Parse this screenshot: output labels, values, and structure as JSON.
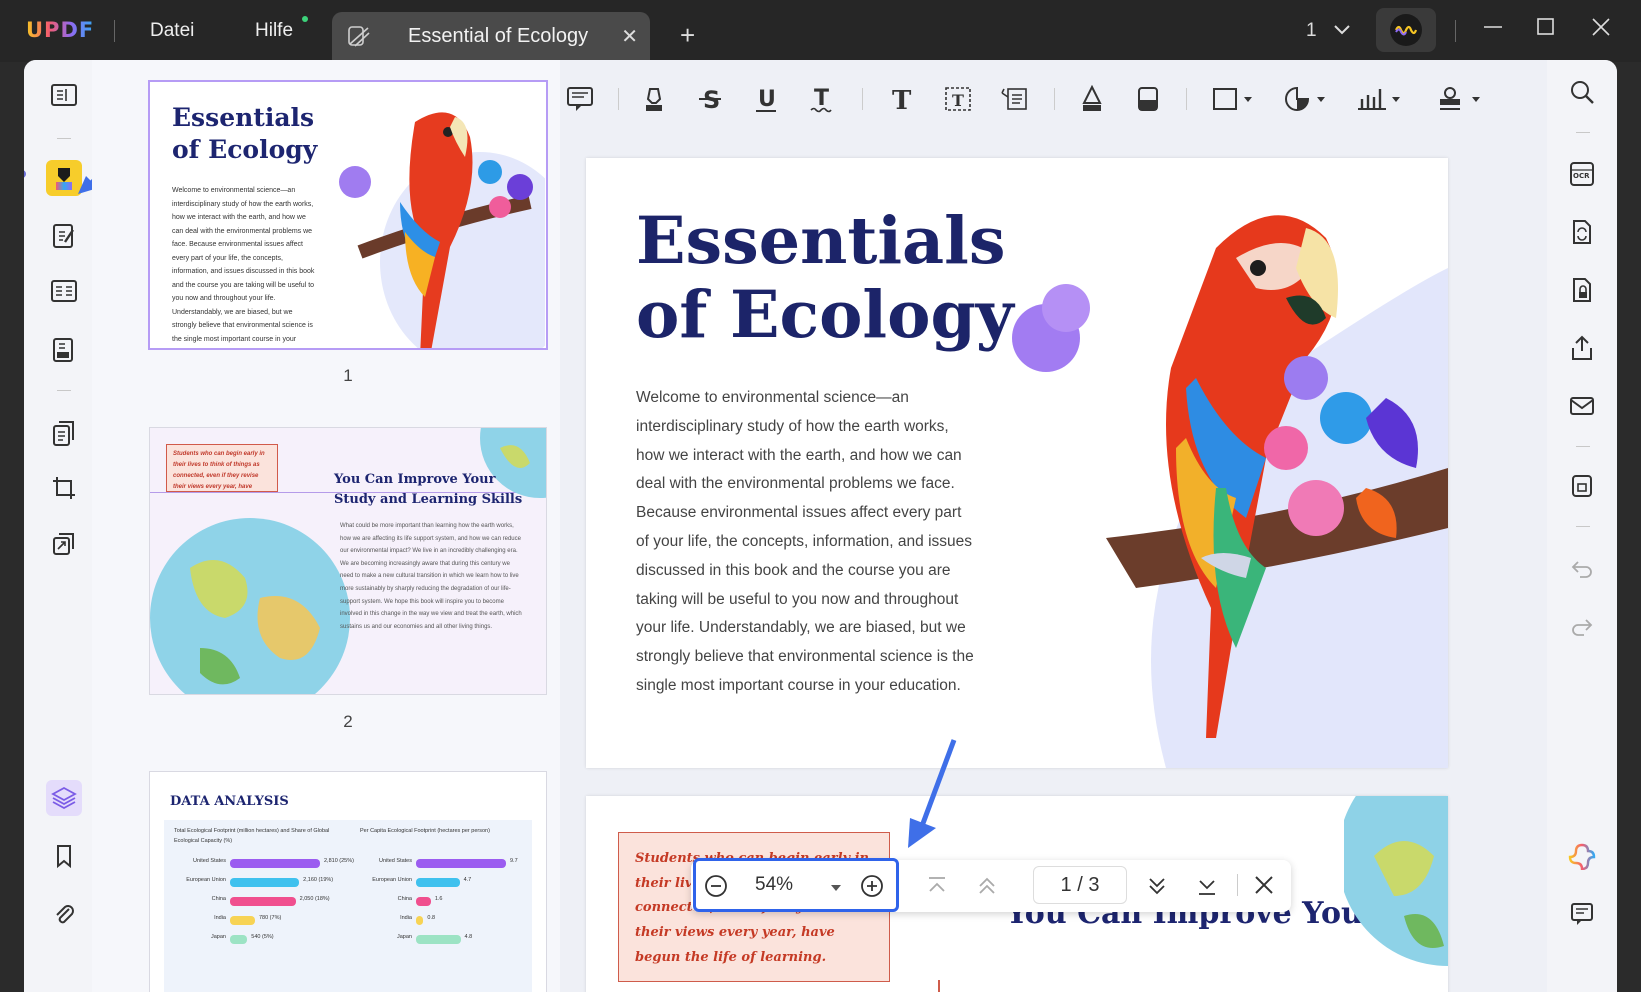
{
  "app": {
    "logo": "UPDF"
  },
  "menu": {
    "file": "Datei",
    "help": "Hilfe"
  },
  "tab": {
    "title": "Essential of Ecology",
    "close": "✕",
    "new": "+"
  },
  "window": {
    "page_selector": "1"
  },
  "thumbnails": [
    {
      "number": "1",
      "title_line1": "Essentials",
      "title_line2": "of Ecology",
      "body": "Welcome to environmental science—an interdisciplinary study of how the earth works, how we interact with the earth, and how we can deal with the environmental problems we face. Because environmental issues affect every part of your life, the concepts, information, and issues discussed in this book and the course you are taking will be useful to you now and throughout your life. Understandably, we are biased, but we strongly believe that environmental science is the single most important course in your education."
    },
    {
      "number": "2",
      "callout": "Students who can begin early in their lives to think of things as connected, even if they revise their views every year, have begun the life of learning.",
      "heading": "You Can Improve Your Study and Learning Skills",
      "body": "What could be more important than learning how the earth works, how we are affecting its life support system, and how we can reduce our environmental impact? We live in an incredibly challenging era. We are becoming increasingly aware that during this century we need to make a new cultural transition in which we learn how to live more sustainably by sharply reducing the degradation of our life-support system. We hope this book will inspire you to become involved in this change in the way we view and treat the earth, which sustains us and our economies and all other living things."
    },
    {
      "number": "3",
      "heading": "DATA ANALYSIS",
      "left_legend": "Total Ecological Footprint (million hectares) and Share of Global Ecological Capacity (%)",
      "right_legend": "Per Capita Ecological Footprint (hectares per person)"
    }
  ],
  "chart_data": [
    {
      "type": "bar",
      "title": "DATA ANALYSIS",
      "series": [
        {
          "name": "Total Ecological Footprint (million hectares) and Share of Global Ecological Capacity (%)",
          "values": [
            2810,
            2160,
            2050,
            780,
            540
          ]
        }
      ],
      "categories": [
        "United States",
        "European Union",
        "China",
        "India",
        "Japan"
      ],
      "data_labels": [
        "2,810 (25%)",
        "2,160 (19%)",
        "2,050 (18%)",
        "780 (7%)",
        "540 (5%)"
      ],
      "colors": [
        "#9b5cf0",
        "#3fc1ee",
        "#f04f8e",
        "#f7d354",
        "#9ce3c4"
      ]
    },
    {
      "type": "bar",
      "series": [
        {
          "name": "Per Capita Ecological Footprint (hectares per person)",
          "values": [
            9.7,
            4.7,
            1.6,
            0.8,
            4.8
          ]
        }
      ],
      "categories": [
        "United States",
        "European Union",
        "China",
        "India",
        "Japan"
      ],
      "data_labels": [
        "9.7",
        "4.7",
        "1.6",
        "0.8",
        "4.8"
      ],
      "colors": [
        "#9b5cf0",
        "#3fc1ee",
        "#f04f8e",
        "#f7d354",
        "#9ce3c4"
      ]
    }
  ],
  "document": {
    "page1": {
      "title_line1": "Essentials",
      "title_line2": "of Ecology",
      "body": "Welcome to environmental science—an interdisciplinary study of how the earth works, how we interact with the earth, and how we can deal with the environmental problems we face. Because environmental issues affect every part of your life, the concepts, information, and issues discussed in this book and the course you are taking will be useful to you now and throughout your life. Understandably, we are biased, but we strongly believe that environmental science is the single most important course in your education."
    },
    "page2": {
      "callout": "Students who can begin early in their lives to think of things as connected, even if they revise their views every year, have begun the life of learning.",
      "heading": "You Can Improve Your"
    }
  },
  "zoom": {
    "value": "54%",
    "page_indicator": "1 / 3"
  },
  "colors": {
    "accent": "#2f63ea",
    "highlight_active": "#f7cd2b",
    "title_navy": "#1c2469",
    "purple": "#8e6bf2"
  }
}
